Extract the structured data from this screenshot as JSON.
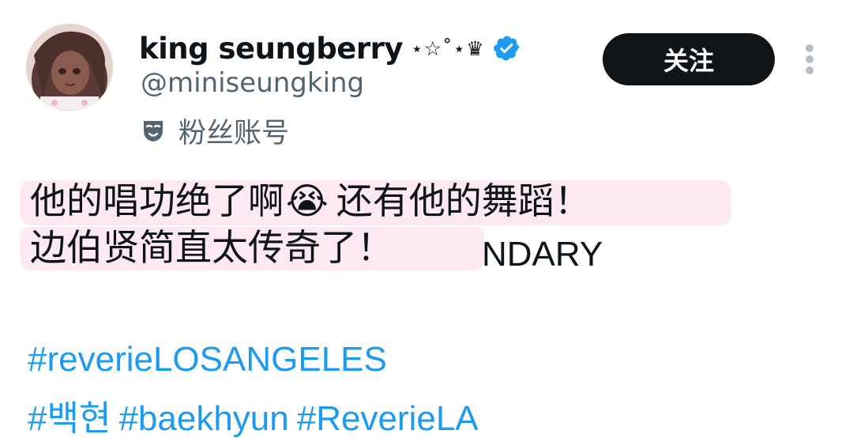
{
  "profile": {
    "display_name": "king seungberry",
    "name_decoration": "⋆☆˚⋆♛",
    "handle": "@miniseungking",
    "account_label": "粉丝账号",
    "account_label_icon": "mask-icon",
    "verified_icon": "verified-badge-icon",
    "avatar_icon": "avatar"
  },
  "actions": {
    "follow_label": "关注",
    "more_icon": "more-vertical-icon"
  },
  "tweet": {
    "line1_a": "他的唱功绝了啊",
    "line1_emoji": "😭",
    "line1_b": "还有他的舞蹈！",
    "line2": "边伯贤简直太传奇了！",
    "line2_tail": "NDARY",
    "hashtags_line1": [
      "#reverieLOSANGELES"
    ],
    "hashtags_line2": [
      "#백현",
      "#baekhyun",
      "#ReverieLA"
    ]
  },
  "colors": {
    "text_primary": "#0f1419",
    "text_secondary": "#536471",
    "link": "#1d9bf0",
    "verified": "#1d9bf0",
    "follow_bg": "#0f1419",
    "translation_highlight": "#fde9f1"
  }
}
